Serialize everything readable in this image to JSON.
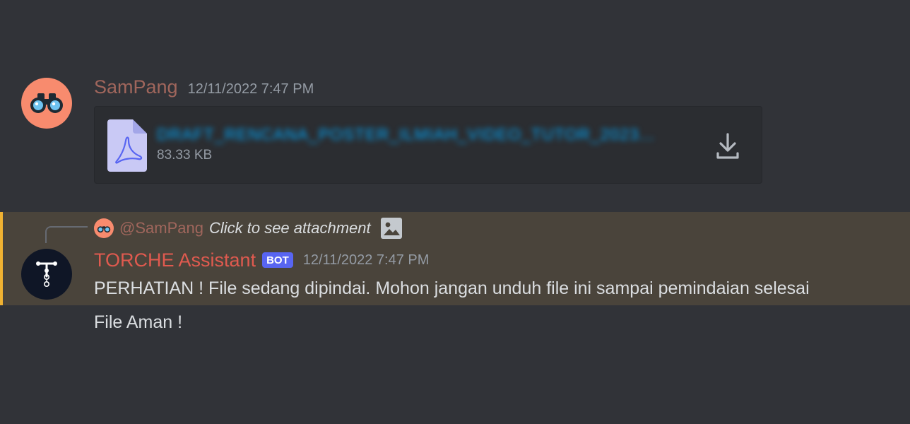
{
  "colors": {
    "background": "#313338",
    "highlight_background": "#4a443b",
    "highlight_border": "#f0b232",
    "username_sampang": "#a0665c",
    "username_bot": "#e05a4f",
    "bot_tag": "#5865f2",
    "link": "#00a8fc"
  },
  "message1": {
    "author": "SamPang",
    "timestamp": "12/11/2022 7:47 PM",
    "avatar_icon": "binoculars-icon",
    "attachment": {
      "file_icon": "pdf-file-icon",
      "file_name": "DRAFT_RENCANA_POSTER_ILMIAH_VIDEO_TUTOR_2023...",
      "file_size": "83.33 KB",
      "download_icon": "download-icon"
    }
  },
  "message2": {
    "reply": {
      "mention": "@SamPang",
      "text": "Click to see attachment",
      "icon": "image-icon"
    },
    "author": "TORCHE Assistant",
    "bot_tag": "BOT",
    "timestamp": "12/11/2022 7:47 PM",
    "avatar_icon": "torch-logo-icon",
    "lines": [
      "PERHATIAN ! File sedang dipindai. Mohon jangan unduh file ini sampai pemindaian selesai",
      "File Aman !"
    ]
  }
}
